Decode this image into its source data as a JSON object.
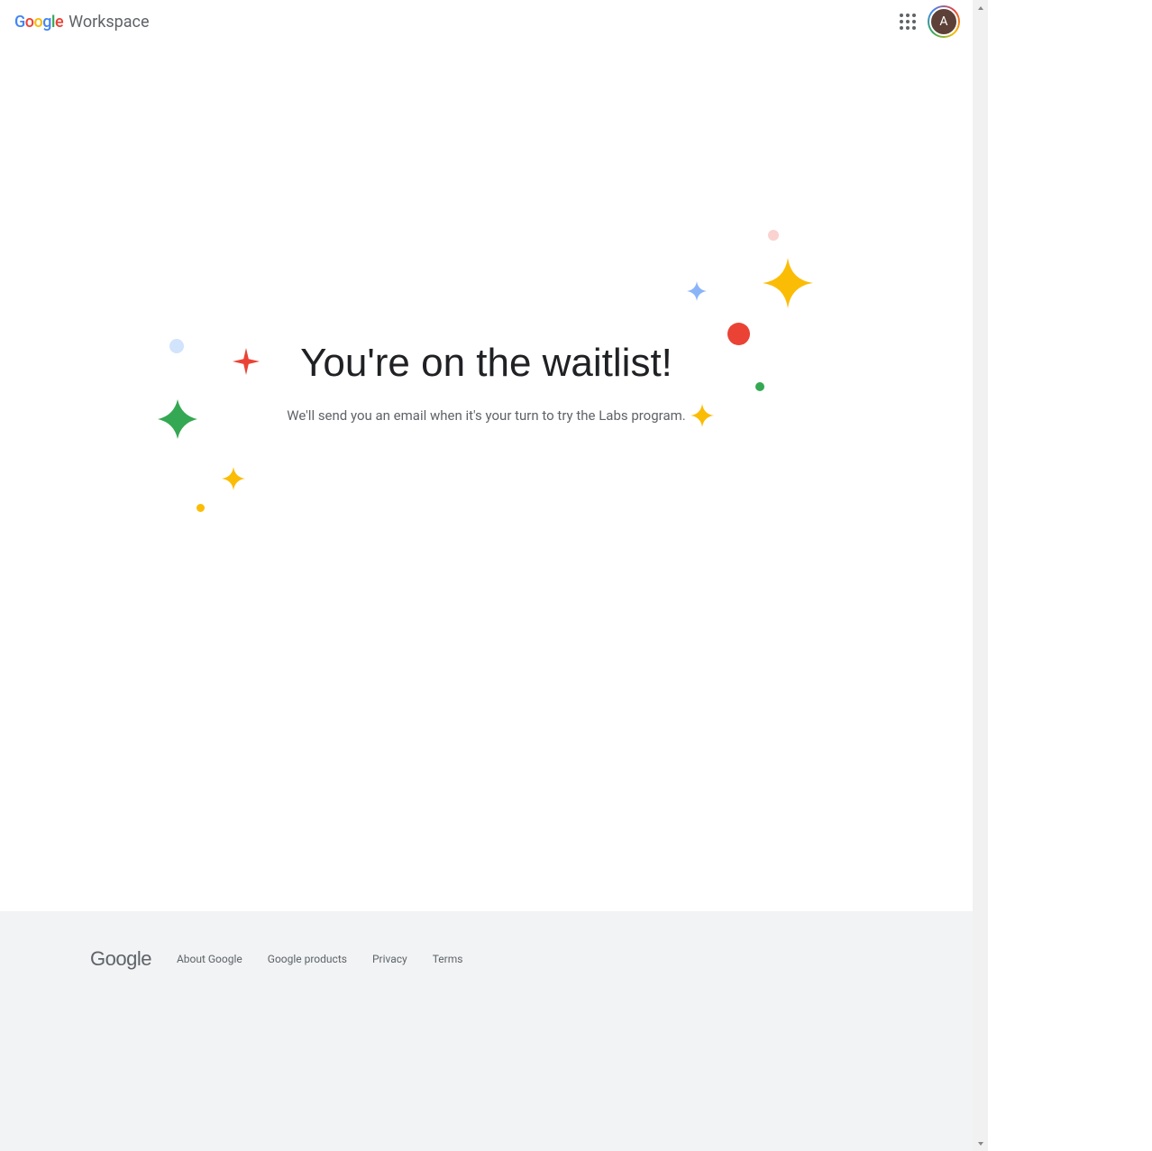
{
  "header": {
    "product_name": "Workspace",
    "avatar_initial": "A"
  },
  "main": {
    "title": "You're on the waitlist!",
    "subtitle": "We'll send you an email when it's your turn to try the Labs program."
  },
  "footer": {
    "brand": "Google",
    "links": [
      "About Google",
      "Google products",
      "Privacy",
      "Terms"
    ]
  },
  "colors": {
    "red": "#EA4335",
    "yellow": "#FBBC05",
    "green": "#34A853",
    "blue": "#4285F4",
    "lightblue": "#a8c7fa",
    "pink": "#fad2cf",
    "paleblue": "#d2e3fc"
  }
}
